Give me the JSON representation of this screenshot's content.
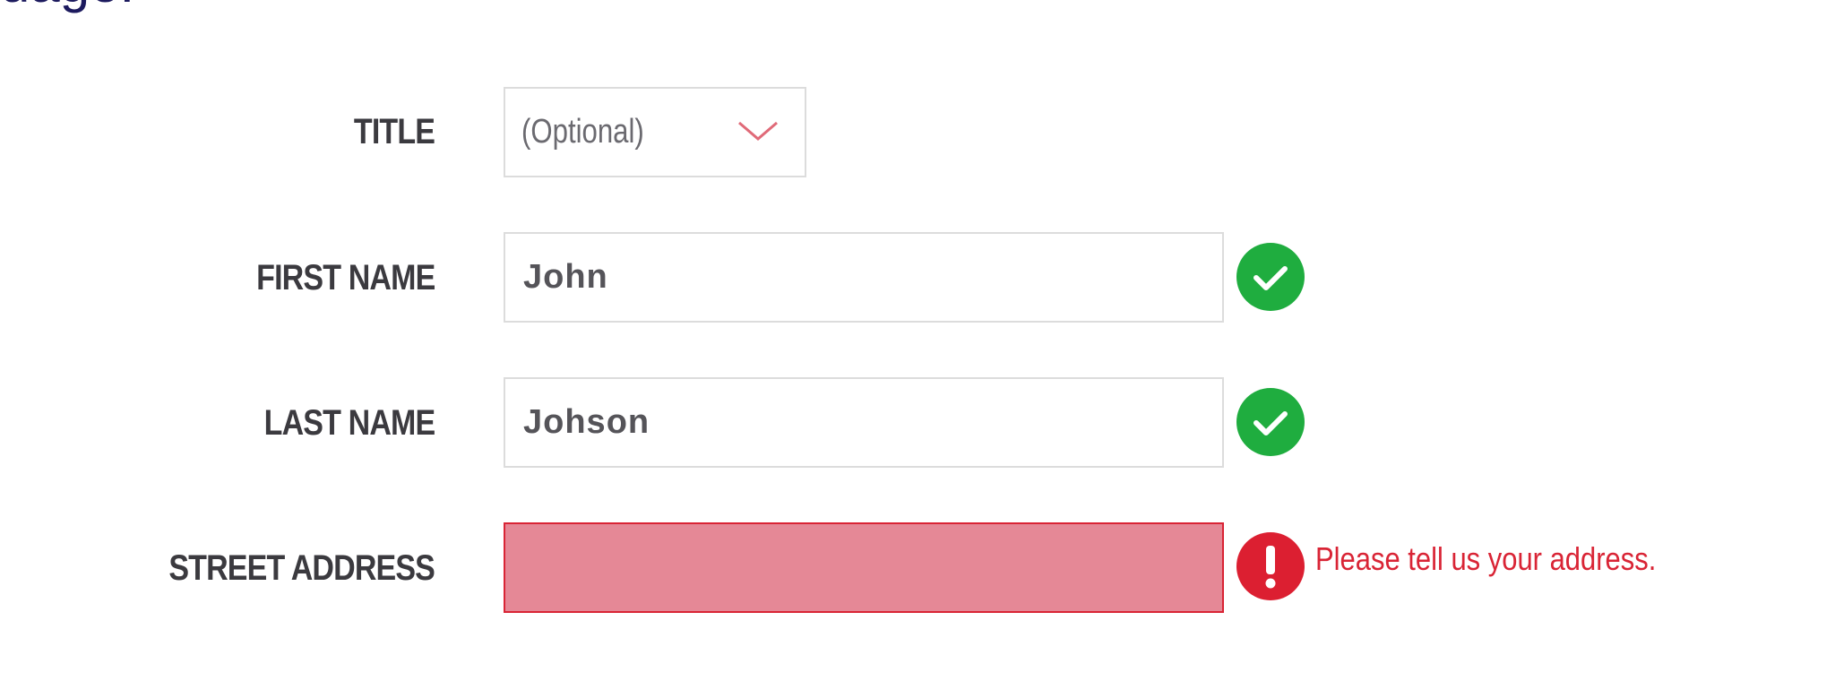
{
  "page": {
    "heading_fragment": "uage."
  },
  "form": {
    "title": {
      "label": "TITLE",
      "selected_value": "(Optional)"
    },
    "first_name": {
      "label": "FIRST NAME",
      "value": "John",
      "status": "valid"
    },
    "last_name": {
      "label": "LAST NAME",
      "value": "Johson",
      "status": "valid"
    },
    "street_address": {
      "label": "STREET ADDRESS",
      "value": "",
      "status": "invalid",
      "error_message": "Please tell us your address."
    }
  },
  "icons": {
    "valid": "check-circle-icon",
    "invalid": "exclamation-circle-icon",
    "dropdown": "chevron-down-icon"
  },
  "colors": {
    "heading": "#1c1a5e",
    "label": "#3b3a3f",
    "valid": "#1fad3f",
    "error": "#dc1f31",
    "error_field_bg": "#e58896",
    "chevron": "#e06a78",
    "field_border": "#dcdcdc"
  }
}
